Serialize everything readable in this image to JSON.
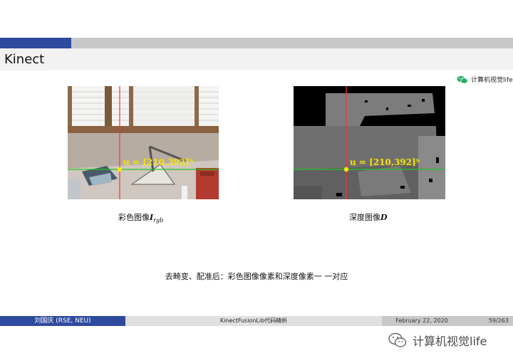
{
  "header": {
    "title": "Kinect"
  },
  "watermark": {
    "small": "计算机视觉life",
    "large": "计算机视觉life",
    "icon": "wechat-icon"
  },
  "figures": {
    "rgb": {
      "annotation": "u = [210,392]ᵀ",
      "caption_prefix": "彩色图像",
      "caption_symbol": "I",
      "caption_sub": "rgb"
    },
    "depth": {
      "annotation": "u = [210,392]ᵀ",
      "caption_prefix": "深度图像",
      "caption_symbol": "D"
    }
  },
  "note": "去畸变、配准后：彩色图像像素和深度像素一 一对应",
  "footer": {
    "author": "刘国庆 (RSE, NEU)",
    "title": "KinectFusionLib代码精析",
    "date": "February 22, 2020",
    "page": "59/263"
  },
  "colors": {
    "accent": "#2e4a9e",
    "bar_gray": "#c8c8c8",
    "marker": "#f7e600",
    "vline": "#ff3030",
    "hline": "#22c522"
  }
}
